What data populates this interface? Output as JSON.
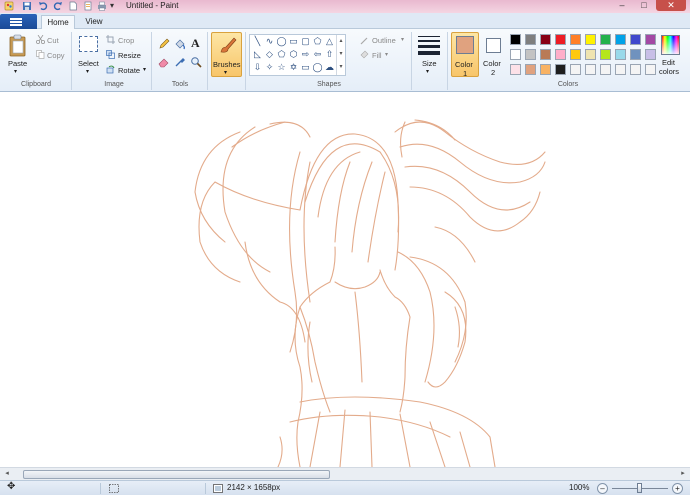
{
  "window": {
    "title": "Untitled - Paint",
    "minimize_label": "–",
    "maximize_label": "□",
    "close_label": "✕"
  },
  "ribbon_tabs": [
    {
      "label": "Home",
      "active": true
    },
    {
      "label": "View",
      "active": false
    }
  ],
  "clipboard": {
    "paste": "Paste",
    "cut": "Cut",
    "copy": "Copy",
    "group": "Clipboard"
  },
  "image": {
    "select": "Select",
    "crop": "Crop",
    "resize": "Resize",
    "rotate": "Rotate",
    "group": "Image"
  },
  "tools": {
    "group": "Tools"
  },
  "brushes": {
    "label": "Brushes"
  },
  "shapes": {
    "outline": "Outline",
    "fill": "Fill",
    "group": "Shapes",
    "icons": [
      "line",
      "curve",
      "oval",
      "rectangle",
      "rounded-rectangle",
      "polygon",
      "triangle",
      "right-triangle",
      "diamond",
      "pentagon",
      "hexagon",
      "right-arrow",
      "left-arrow",
      "up-arrow",
      "down-arrow",
      "four-point-star",
      "five-point-star",
      "six-point-star",
      "rect-callout",
      "oval-callout",
      "cloud-callout",
      "heart",
      "lightning"
    ]
  },
  "size": {
    "label": "Size"
  },
  "color1": {
    "label": "Color",
    "num": "1",
    "value": "#e0a27f"
  },
  "color2": {
    "label": "Color",
    "num": "2",
    "value": "#ffffff"
  },
  "colors": {
    "group": "Colors",
    "edit_label_1": "Edit",
    "edit_label_2": "colors",
    "row1": [
      "#000000",
      "#7f7f7f",
      "#880015",
      "#ed1c24",
      "#ff7f27",
      "#fff200",
      "#22b14c",
      "#00a2e8",
      "#3f48cc",
      "#a349a4"
    ],
    "row2": [
      "#ffffff",
      "#c3c3c3",
      "#b97a57",
      "#ffaec9",
      "#ffc90e",
      "#efe4b0",
      "#b5e61d",
      "#99d9ea",
      "#7092be",
      "#c8bfe7"
    ],
    "row3": [
      "#fde1e8",
      "#e0a27f",
      "#f8b263",
      "#1e1e1e",
      "#f4f4f4",
      "#f4f4f4",
      "#f4f4f4",
      "#f4f4f4",
      "#f4f4f4",
      "#f4f4f4"
    ]
  },
  "status": {
    "dimensions": "2142 × 1658px",
    "zoom": "100%",
    "zoom_out": "–",
    "zoom_in": "+"
  },
  "stroke_color": "#e0a27f"
}
